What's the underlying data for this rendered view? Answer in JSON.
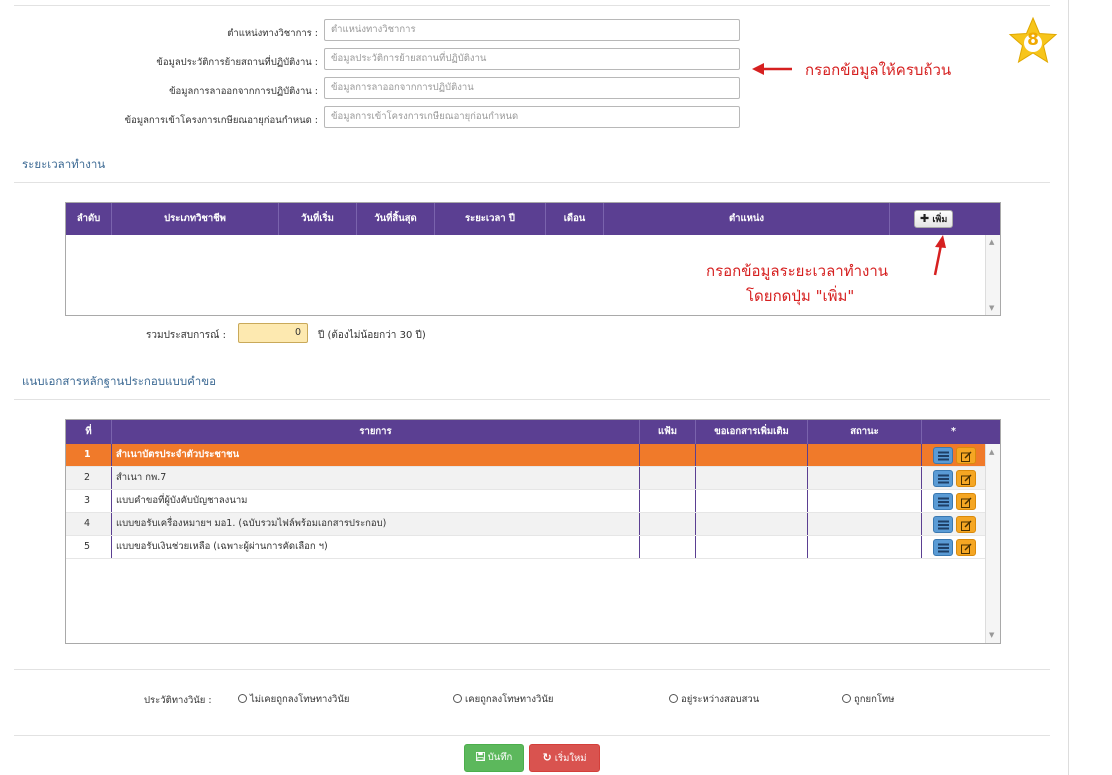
{
  "form": {
    "fields": [
      {
        "label": "ตำแหน่งทางวิชาการ :",
        "placeholder": "ตำแหน่งทางวิชาการ",
        "value": ""
      },
      {
        "label": "ข้อมูลประวัติการย้ายสถานที่ปฏิบัติงาน :",
        "placeholder": "ข้อมูลประวัติการย้ายสถานที่ปฏิบัติงาน",
        "value": ""
      },
      {
        "label": "ข้อมูลการลาออกจากการปฏิบัติงาน :",
        "placeholder": "ข้อมูลการลาออกจากการปฏิบัติงาน",
        "value": ""
      },
      {
        "label": "ข้อมูลการเข้าโครงการเกษียณอายุก่อนกำหนด :",
        "placeholder": "ข้อมูลการเข้าโครงการเกษียณอายุก่อนกำหนด",
        "value": ""
      }
    ],
    "annotation": "กรอกข้อมูลให้ครบถ้วน",
    "step_badge": "8",
    "step_badge_color": "#f7c51b"
  },
  "work_period": {
    "title": "ระยะเวลาทำงาน",
    "columns": [
      "ลำดับ",
      "ประเภทวิชาชีพ",
      "วันที่เริ่ม",
      "วันที่สิ้นสุด",
      "ระยะเวลา ปี",
      "เดือน",
      "ตำแหน่ง"
    ],
    "add_button": "เพิ่ม",
    "annotation_line1": "กรอกข้อมูลระยะเวลาทำงาน",
    "annotation_line2": "โดยกดปุ่ม \"เพิ่ม\"",
    "total_label": "รวมประสบการณ์ :",
    "total_value": "0",
    "total_note": "ปี (ต้องไม่น้อยกว่า 30 ปี)"
  },
  "documents": {
    "title": "แนบเอกสารหลักฐานประกอบแบบคำขอ",
    "columns": [
      "ที่",
      "รายการ",
      "แฟ้ม",
      "ขอเอกสารเพิ่มเติม",
      "สถานะ",
      "*"
    ],
    "rows": [
      {
        "no": "1",
        "item": "สำเนาบัตรประจำตัวประชาชน",
        "file": "",
        "request": "",
        "status": ""
      },
      {
        "no": "2",
        "item": "สำเนา กพ.7",
        "file": "",
        "request": "",
        "status": ""
      },
      {
        "no": "3",
        "item": "แบบคำขอที่ผู้บังคับบัญชาลงนาม",
        "file": "",
        "request": "",
        "status": ""
      },
      {
        "no": "4",
        "item": "แบบขอรับเครื่องหมายฯ มอ1. (ฉบับรวมไฟล์พร้อมเอกสารประกอบ)",
        "file": "",
        "request": "",
        "status": ""
      },
      {
        "no": "5",
        "item": "แบบขอรับเงินช่วยเหลือ (เฉพาะผู้ผ่านการคัดเลือก ฯ)",
        "file": "",
        "request": "",
        "status": ""
      }
    ],
    "selected_row": 1,
    "row_actions": [
      "list-icon",
      "edit-icon"
    ]
  },
  "discipline": {
    "label": "ประวัติทางวินัย :",
    "options": [
      "ไม่เคยถูกลงโทษทางวินัย",
      "เคยถูกลงโทษทางวินัย",
      "อยู่ระหว่างสอบสวน",
      "ถูกยกโทษ"
    ]
  },
  "actions": {
    "save": "บันทึก",
    "reset": "เริ่มใหม่"
  },
  "colors": {
    "header": "#5b3f92",
    "selected_row": "#f07a2a",
    "annotation": "#d62020",
    "save": "#5cb85c",
    "reset": "#d9534f"
  }
}
